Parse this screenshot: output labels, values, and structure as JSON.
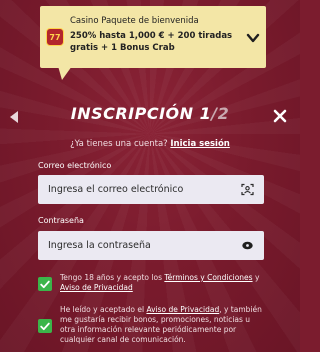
{
  "banner": {
    "title": "Casino Paquete de bienvenida",
    "text": "250% hasta 1,000 € + 200 tiradas gratis + 1 Bonus Crab",
    "slot_icon_text": "77"
  },
  "header": {
    "title_main": "INSCRIPCIÓN 1",
    "title_sep": "/",
    "title_total": "2"
  },
  "login_prompt": {
    "text": "¿Ya tienes una cuenta?",
    "link": "Inicia sesión"
  },
  "email": {
    "label": "Correo electrónico",
    "placeholder": "Ingresa el correo electrónico"
  },
  "password": {
    "label": "Contraseña",
    "placeholder": "Ingresa la contraseña"
  },
  "terms": {
    "text_before": "Tengo 18 años y acepto los ",
    "terms_link": "Términos y Condiciones",
    "text_middle": " y ",
    "privacy_link": "Aviso de Privacidad",
    "checked": true
  },
  "marketing": {
    "text_before": "He leído y aceptado el ",
    "privacy_link": "Aviso de Privacidad",
    "text_after": ", y también me gustaría recibir bonos, promociones, noticias u otra información relevante periódicamente por cualquier canal de comunicación.",
    "checked": true
  },
  "colors": {
    "background": "#7b1c2e",
    "banner": "#f3e6a6",
    "checkbox": "#3bb54a",
    "field": "#ebe9f2"
  }
}
